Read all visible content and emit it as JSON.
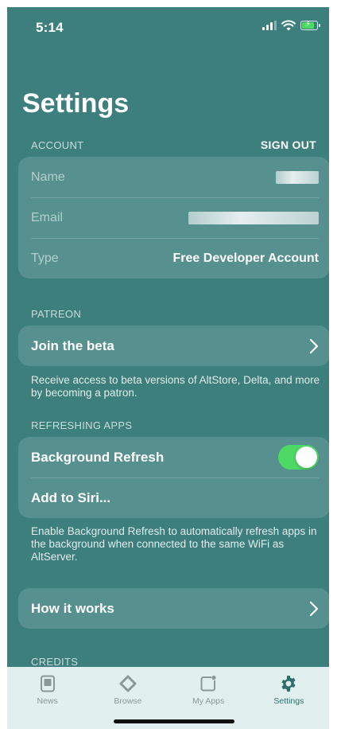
{
  "status_bar": {
    "time": "5:14"
  },
  "title": "Settings",
  "account": {
    "header": "ACCOUNT",
    "sign_out_label": "SIGN OUT",
    "rows": [
      {
        "label": "Name",
        "value": ""
      },
      {
        "label": "Email",
        "value": ""
      },
      {
        "label": "Type",
        "value": "Free Developer Account"
      }
    ]
  },
  "patreon": {
    "header": "PATREON",
    "join_label": "Join the beta",
    "footer": "Receive access to beta versions of AltStore, Delta, and more by becoming a patron."
  },
  "refreshing_apps": {
    "header": "REFRESHING APPS",
    "background_refresh_label": "Background Refresh",
    "background_refresh_enabled": true,
    "add_to_siri_label": "Add to Siri...",
    "footer": "Enable Background Refresh to automatically refresh apps in the background when connected to the same WiFi as AltServer."
  },
  "how_it_works": {
    "label": "How it works"
  },
  "credits": {
    "header": "CREDITS"
  },
  "tab_bar": {
    "items": [
      {
        "label": "News",
        "icon": "news-icon"
      },
      {
        "label": "Browse",
        "icon": "browse-icon"
      },
      {
        "label": "My Apps",
        "icon": "my-apps-icon"
      },
      {
        "label": "Settings",
        "icon": "gear-icon",
        "active": true
      }
    ]
  },
  "colors": {
    "background": "#3c7f7d",
    "toggle_on": "#4cd964",
    "tab_bar_background": "#e1f0ef",
    "tab_active": "#2f6d6b"
  }
}
